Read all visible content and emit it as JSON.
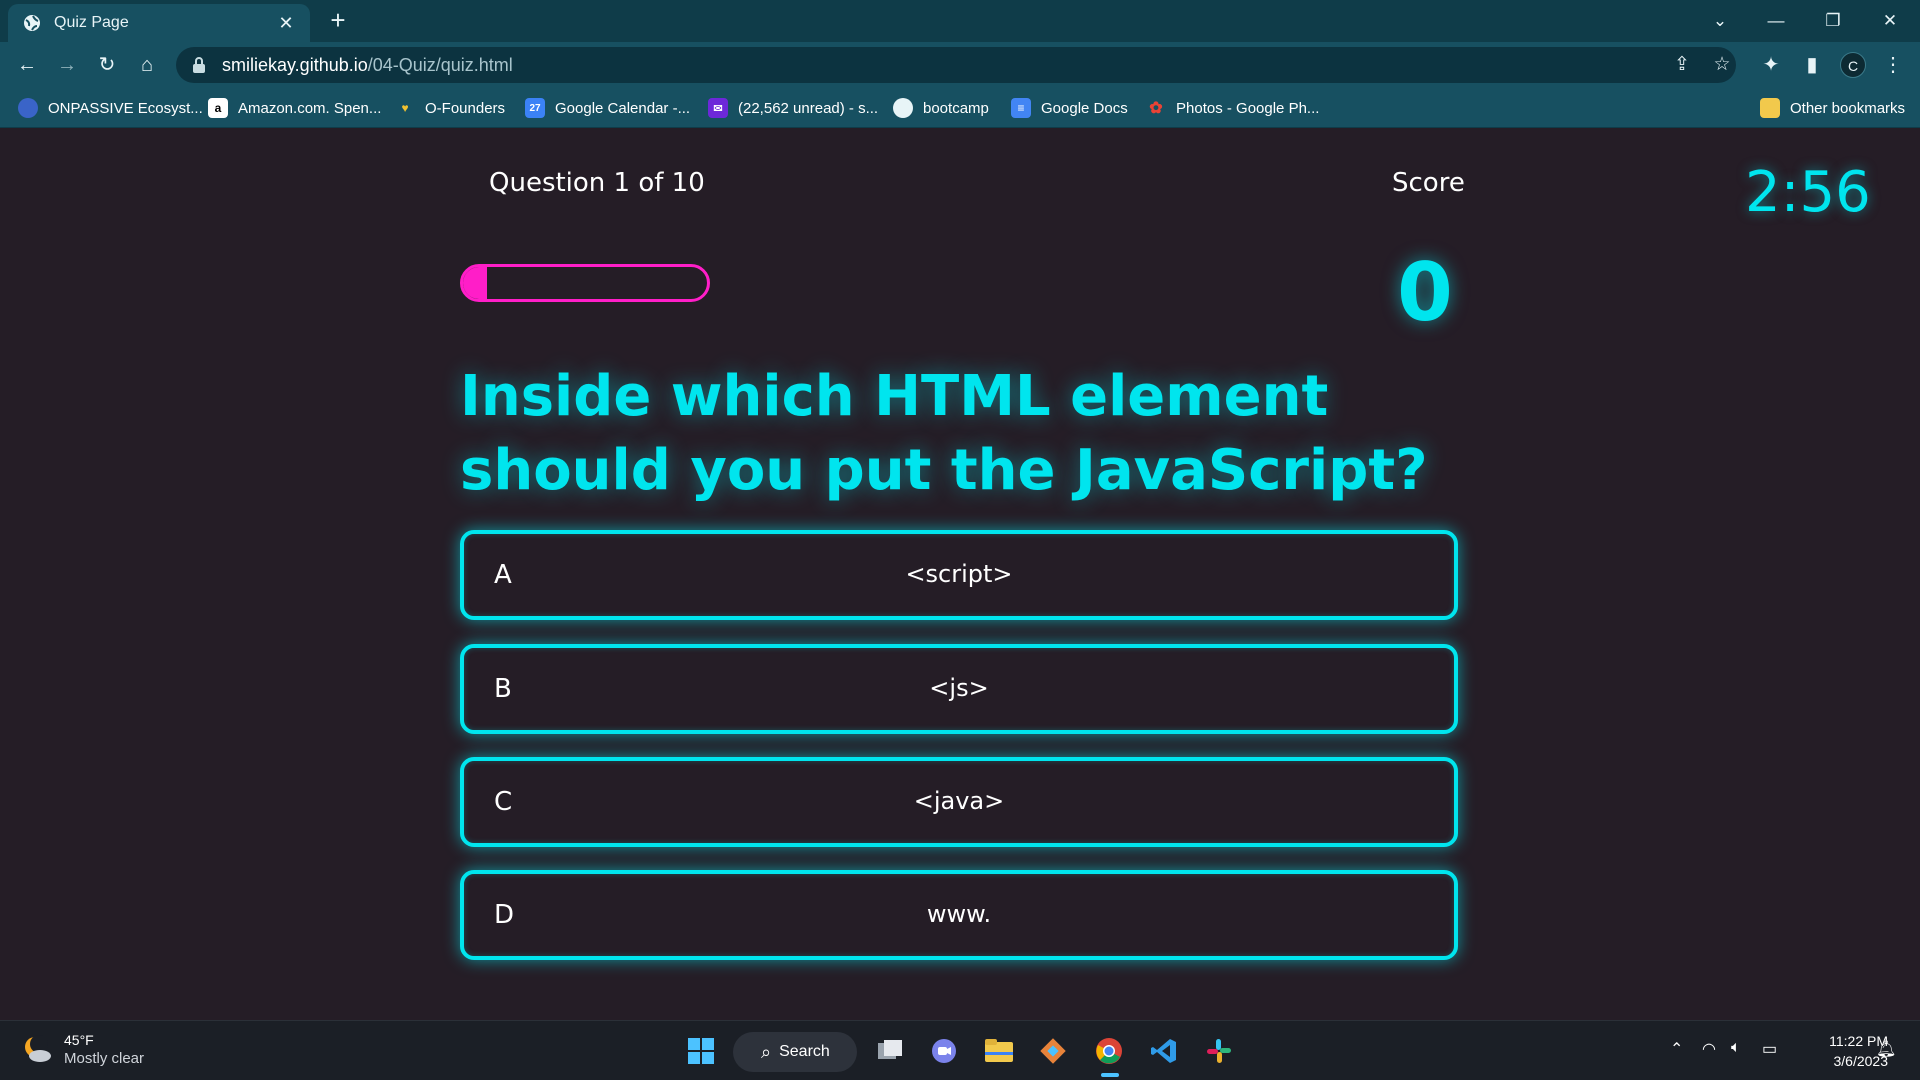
{
  "browser": {
    "tab_title": "Quiz Page",
    "url_host": "smiliekay.github.io",
    "url_path": "/04-Quiz/quiz.html",
    "bookmarks": [
      {
        "label": "ONPASSIVE Ecosyst...",
        "icon": "onpassive-icon"
      },
      {
        "label": "Amazon.com. Spen...",
        "icon": "amazon-icon"
      },
      {
        "label": "O-Founders",
        "icon": "ofounders-icon"
      },
      {
        "label": "Google Calendar -...",
        "icon": "calendar-icon"
      },
      {
        "label": "(22,562 unread) - s...",
        "icon": "mail-icon"
      },
      {
        "label": "bootcamp",
        "icon": "globe-icon"
      },
      {
        "label": "Google Docs",
        "icon": "docs-icon"
      },
      {
        "label": "Photos - Google Ph...",
        "icon": "photos-icon"
      }
    ],
    "other_bookmarks": "Other bookmarks",
    "profile_initial": "C"
  },
  "quiz": {
    "question_counter": "Question 1 of 10",
    "score_label": "Score",
    "score_value": "0",
    "timer": "2:56",
    "progress_fraction": 0.1,
    "question": "Inside which HTML element should you put the JavaScript?",
    "choices": [
      {
        "letter": "A",
        "text": "<script>"
      },
      {
        "letter": "B",
        "text": "<js>"
      },
      {
        "letter": "C",
        "text": "<java>"
      },
      {
        "letter": "D",
        "text": "www."
      }
    ],
    "colors": {
      "accent": "#00e5ee",
      "progress": "#ff1ec8",
      "background": "#251d26"
    }
  },
  "taskbar": {
    "temperature": "45°F",
    "weather": "Mostly clear",
    "search_label": "Search",
    "time": "11:22 PM",
    "date": "3/6/2023"
  }
}
